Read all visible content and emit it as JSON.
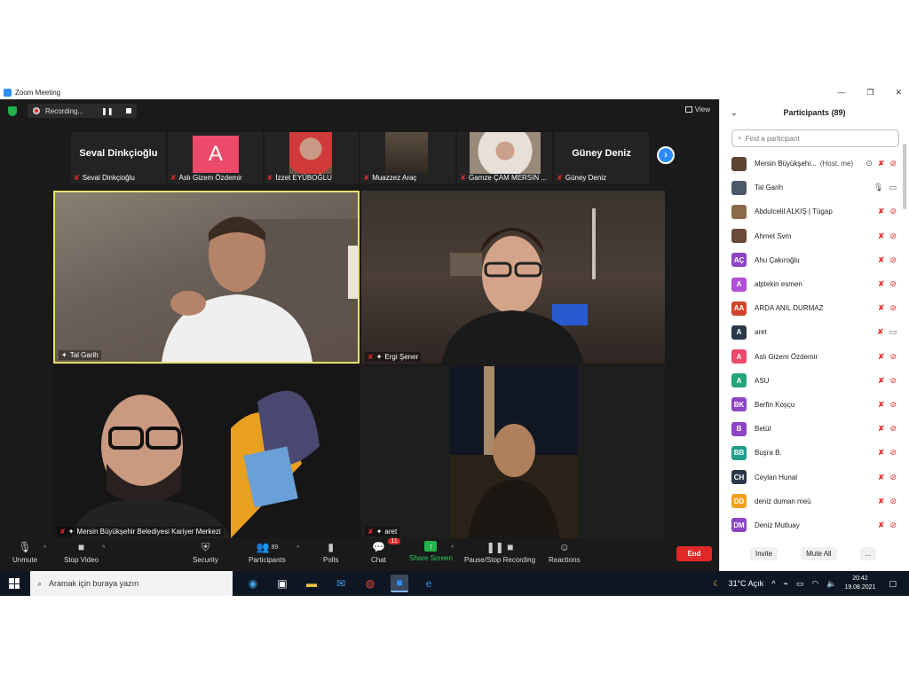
{
  "window": {
    "title": "Zoom Meeting"
  },
  "topbar": {
    "recording_label": "Recording...",
    "view_label": "View"
  },
  "strip": [
    {
      "label": "Seval Dinkçioğlu",
      "big": "Seval Dinkçioğlu",
      "kind": "name"
    },
    {
      "label": "Aslı Gizem Özdemir",
      "big": "A",
      "kind": "avatar"
    },
    {
      "label": "İzzet EYÜBOĞLU",
      "kind": "photo",
      "color": "#6b5448"
    },
    {
      "label": "Muazzez Araç",
      "kind": "photo",
      "color": "#3b342c"
    },
    {
      "label": "Gamze ÇAM MERSİN ...",
      "kind": "photo",
      "color": "#b7a597"
    },
    {
      "label": "Güney Deniz",
      "big": "Güney Deniz",
      "kind": "name"
    }
  ],
  "tiles": [
    {
      "label": "Tal Garih"
    },
    {
      "label": "Ergi Şener"
    },
    {
      "label": "Mersin Büyükşehir Belediyesi Kariyer Merkezi"
    },
    {
      "label": "aret"
    }
  ],
  "toolbar": {
    "unmute": "Unmute",
    "stop_video": "Stop Video",
    "security": "Security",
    "participants": "Participants",
    "participants_count": "89",
    "polls": "Polls",
    "chat": "Chat",
    "chat_badge": "11",
    "share_screen": "Share Screen",
    "pause_stop": "Pause/Stop Recording",
    "reactions": "Reactions",
    "end": "End"
  },
  "panel": {
    "title": "Participants (89)",
    "search_placeholder": "Find a participant",
    "invite": "Invite",
    "mute_all": "Mute All",
    "more": "...",
    "participants": [
      {
        "name": "Mersin Büyükşehi...",
        "role": "(Host, me)",
        "initials": "",
        "color": "#5a4434",
        "mic": "off",
        "cam": "off",
        "rec": true
      },
      {
        "name": "Tal Garih",
        "initials": "",
        "color": "#4a5a6a",
        "mic": "on",
        "cam": "on"
      },
      {
        "name": "Abdulcelil ALKIŞ | Tügap",
        "initials": "",
        "color": "#8a6a4a",
        "mic": "off",
        "cam": "off"
      },
      {
        "name": "Ahmet Svm",
        "initials": "",
        "color": "#6a4a3a",
        "mic": "off",
        "cam": "off"
      },
      {
        "name": "Ahu Çakıroğlu",
        "initials": "AÇ",
        "color": "#8e44c6",
        "mic": "off",
        "cam": "off"
      },
      {
        "name": "alptekin esmen",
        "initials": "A",
        "color": "#b14ed4",
        "mic": "off",
        "cam": "off"
      },
      {
        "name": "ARDA ANIL DURMAZ",
        "initials": "AA",
        "color": "#d2452e",
        "mic": "off",
        "cam": "off"
      },
      {
        "name": "aret",
        "initials": "A",
        "color": "#2b3a4a",
        "mic": "off",
        "cam": "on"
      },
      {
        "name": "Aslı Gizem Özdemir",
        "initials": "A",
        "color": "#ec4a6b",
        "mic": "off",
        "cam": "off"
      },
      {
        "name": "ASU",
        "initials": "A",
        "color": "#22a57a",
        "mic": "off",
        "cam": "off"
      },
      {
        "name": "Berfin Koşçu",
        "initials": "BK",
        "color": "#8e44c6",
        "mic": "off",
        "cam": "off"
      },
      {
        "name": "Betül",
        "initials": "B",
        "color": "#8e44c6",
        "mic": "off",
        "cam": "off"
      },
      {
        "name": "Buşra B.",
        "initials": "BB",
        "color": "#1f9e8a",
        "mic": "off",
        "cam": "off"
      },
      {
        "name": "Ceylan Hunal",
        "initials": "CH",
        "color": "#2b3a4a",
        "mic": "off",
        "cam": "off"
      },
      {
        "name": "deniz duman meü",
        "initials": "DD",
        "color": "#f0a020",
        "mic": "off",
        "cam": "off"
      },
      {
        "name": "Deniz Mutluay",
        "initials": "DM",
        "color": "#8e44c6",
        "mic": "off",
        "cam": "off"
      }
    ]
  },
  "taskbar": {
    "search_placeholder": "Aramak için buraya yazın",
    "weather": "31°C  Açık",
    "time": "20:42",
    "date": "19.08.2021"
  }
}
